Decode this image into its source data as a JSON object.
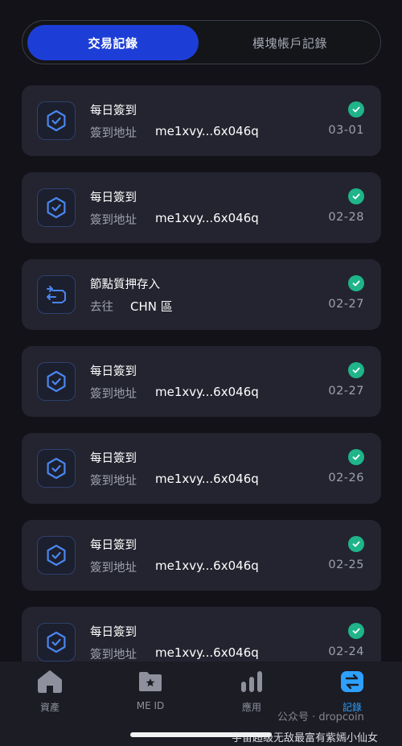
{
  "tabs": {
    "active": "交易記錄",
    "inactive": "模塊帳戶記錄"
  },
  "records": [
    {
      "icon": "hexagon-check-icon",
      "title": "每日簽到",
      "label": "簽到地址",
      "value": "me1xvy...6x046q",
      "date": "03-01"
    },
    {
      "icon": "hexagon-check-icon",
      "title": "每日簽到",
      "label": "簽到地址",
      "value": "me1xvy...6x046q",
      "date": "02-28"
    },
    {
      "icon": "stake-deposit-icon",
      "title": "節點質押存入",
      "label": "去往",
      "value": "CHN 區",
      "date": "02-27"
    },
    {
      "icon": "hexagon-check-icon",
      "title": "每日簽到",
      "label": "簽到地址",
      "value": "me1xvy...6x046q",
      "date": "02-27"
    },
    {
      "icon": "hexagon-check-icon",
      "title": "每日簽到",
      "label": "簽到地址",
      "value": "me1xvy...6x046q",
      "date": "02-26"
    },
    {
      "icon": "hexagon-check-icon",
      "title": "每日簽到",
      "label": "簽到地址",
      "value": "me1xvy...6x046q",
      "date": "02-25"
    },
    {
      "icon": "hexagon-check-icon",
      "title": "每日簽到",
      "label": "簽到地址",
      "value": "me1xvy...6x046q",
      "date": "02-24"
    }
  ],
  "nav": {
    "items": [
      {
        "label": "資產",
        "icon": "home-icon"
      },
      {
        "label": "ME ID",
        "icon": "folder-star-icon"
      },
      {
        "label": "應用",
        "icon": "bar-chart-icon"
      },
      {
        "label": "記錄",
        "icon": "swap-icon"
      }
    ]
  },
  "watermark": {
    "line1": "公众号 · dropcoin",
    "line2": "宇宙超级无敌最富有紫嫣小仙女"
  },
  "colors": {
    "accent": "#1d3ed6",
    "success": "#1fb489",
    "active_nav": "#2ea0ff"
  }
}
